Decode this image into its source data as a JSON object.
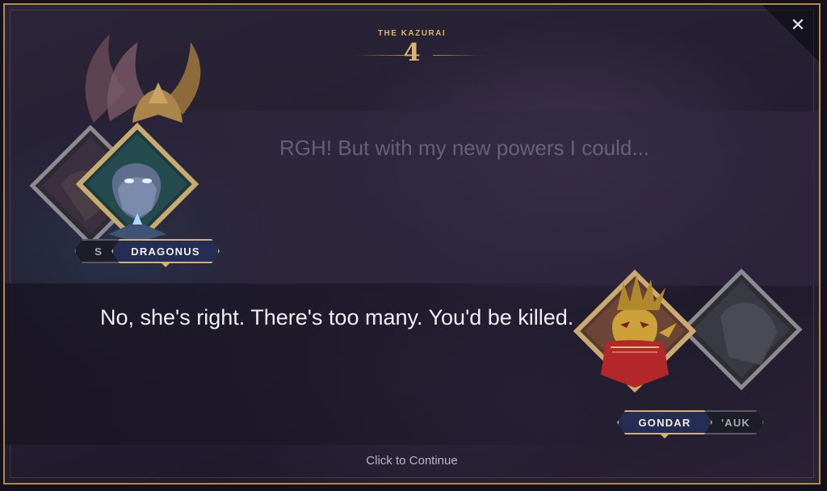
{
  "chapter": {
    "title": "THE KAZURAI",
    "number": "4"
  },
  "close": {
    "label": "✕"
  },
  "dialogue": {
    "previous_line": "RGH! But with my new powers I could...",
    "current_line": "No, she's right. There's too many. You'd be killed."
  },
  "speakers": {
    "left_back_name": "S",
    "left_front_name": "DRAGONUS",
    "right_front_name": "GONDAR",
    "right_back_name": "'AUK"
  },
  "continue_label": "Click to Continue",
  "colors": {
    "gold": "#d9b46a",
    "frame": "#b38a45",
    "nameplate_active": "#262d54"
  }
}
